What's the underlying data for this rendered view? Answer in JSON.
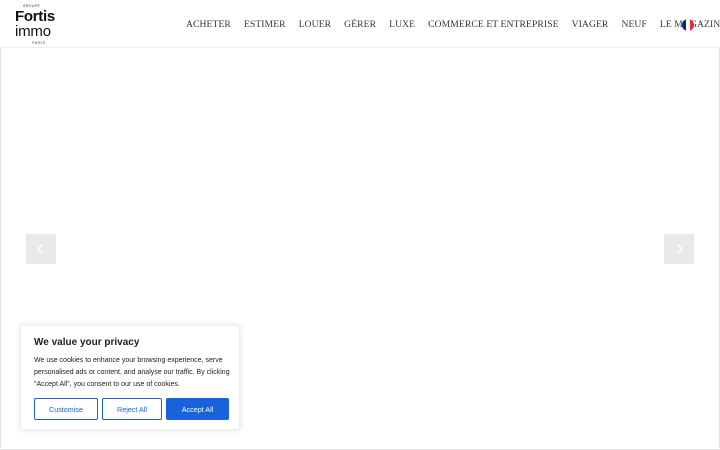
{
  "logo": {
    "group_text": "GROUPE",
    "line1": "Fortis",
    "line2": "immo",
    "city": "PARIS"
  },
  "nav": {
    "items": [
      {
        "label": "ACHETER"
      },
      {
        "label": "ESTIMER"
      },
      {
        "label": "LOUER"
      },
      {
        "label": "GÉRER"
      },
      {
        "label": "LUXE"
      },
      {
        "label": "COMMERCE ET ENTREPRISE"
      },
      {
        "label": "VIAGER"
      },
      {
        "label": "NEUF"
      },
      {
        "label": "LE MAGAZINE"
      }
    ],
    "language_flag": {
      "icon": "french-flag-icon",
      "colors": [
        "#002395",
        "#ffffff",
        "#ed2939"
      ]
    }
  },
  "slider": {
    "prev_icon": "chevron-left-icon",
    "next_icon": "chevron-right-icon",
    "arrow_background": "#e9e9e9"
  },
  "cookie_banner": {
    "title": "We value your privacy",
    "body": "We use cookies to enhance your browsing experience, serve personalised ads or content, and analyse our traffic. By clicking \"Accept All\", you consent to our use of cookies.",
    "customise_label": "Customise",
    "reject_label": "Reject All",
    "accept_label": "Accept All",
    "accent_color": "#1863dc"
  }
}
